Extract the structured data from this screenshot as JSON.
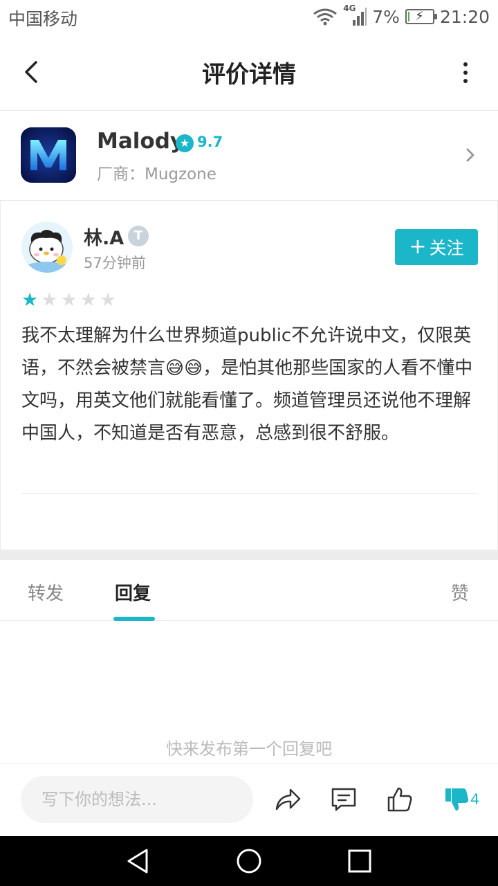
{
  "status_bar": {
    "carrier": "中国移动",
    "network": "4G",
    "battery": "7%",
    "battery_level": 0.07,
    "time": "21:20"
  },
  "header": {
    "title": "评价详情",
    "back_icon": "chevron-left-icon",
    "more_icon": "more-vertical-icon"
  },
  "app": {
    "name": "Malody",
    "score": "9.7",
    "vendor": "厂商：Mugzone",
    "icon": "malody-logo"
  },
  "review": {
    "user": "林.A",
    "badge": "T",
    "time": "57分钟前",
    "follow_label": "关注",
    "rating": 1,
    "rating_max": 5,
    "text": "我不太理解为什么世界频道public不允许说中文，仅限英语，不然会被禁言😅😅，是怕其他那些国家的人看不懂中文吗，用英文他们就能看懂了。频道管理员还说他不理解中国人，不知道是否有恶意，总感到很不舒服。"
  },
  "tabs": {
    "forward": "转发",
    "reply": "回复",
    "like": "赞",
    "active": "reply"
  },
  "empty_hint": "快来发布第一个回复吧",
  "action_bar": {
    "placeholder": "写下你的想法...",
    "dislike_count": "4",
    "colors": {
      "accent": "#1bb6c8"
    }
  }
}
